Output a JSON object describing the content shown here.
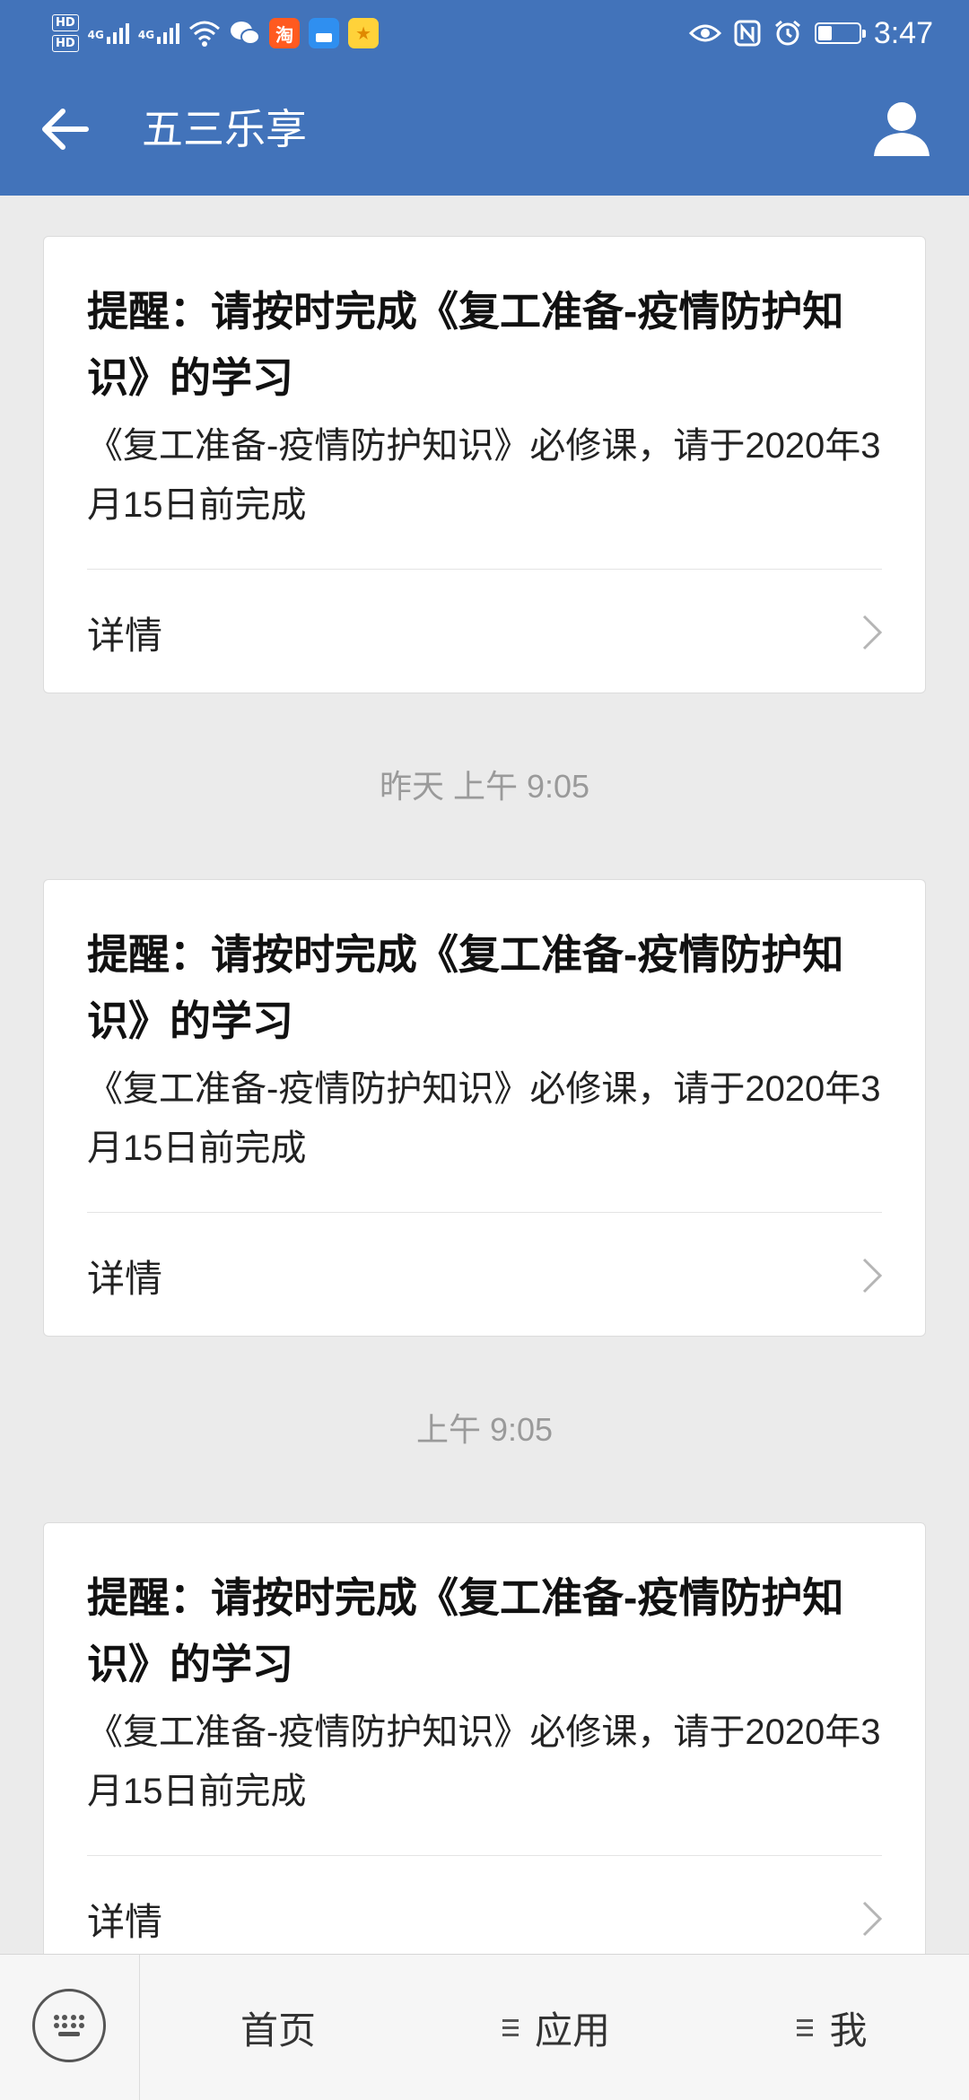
{
  "status_bar": {
    "hd1": "HD",
    "hd2": "HD",
    "sim1": "4G",
    "sim2": "4G",
    "taobao_glyph": "淘",
    "time": "3:47",
    "battery_level": 0.35,
    "icons": [
      "signal-icon",
      "wifi-icon",
      "wechat-icon",
      "taobao-icon",
      "app-icon",
      "star-app-icon",
      "eye-icon",
      "nfc-icon",
      "alarm-icon",
      "battery-icon"
    ]
  },
  "header": {
    "title": "五三乐享",
    "color": "#4273ba"
  },
  "messages": [
    {
      "title": "提醒：请按时完成《复工准备-疫情防护知识》的学习",
      "body": "《复工准备-疫情防护知识》必修课，请于2020年3月15日前完成",
      "detail_label": "详情"
    },
    {
      "title": "提醒：请按时完成《复工准备-疫情防护知识》的学习",
      "body": "《复工准备-疫情防护知识》必修课，请于2020年3月15日前完成",
      "detail_label": "详情"
    },
    {
      "title": "提醒：请按时完成《复工准备-疫情防护知识》的学习",
      "body": "《复工准备-疫情防护知识》必修课，请于2020年3月15日前完成",
      "detail_label": "详情"
    }
  ],
  "timestamps": [
    "昨天  上午 9:05",
    "上午 9:05"
  ],
  "bottom_nav": {
    "items": [
      "首页",
      "应用",
      "我"
    ]
  }
}
